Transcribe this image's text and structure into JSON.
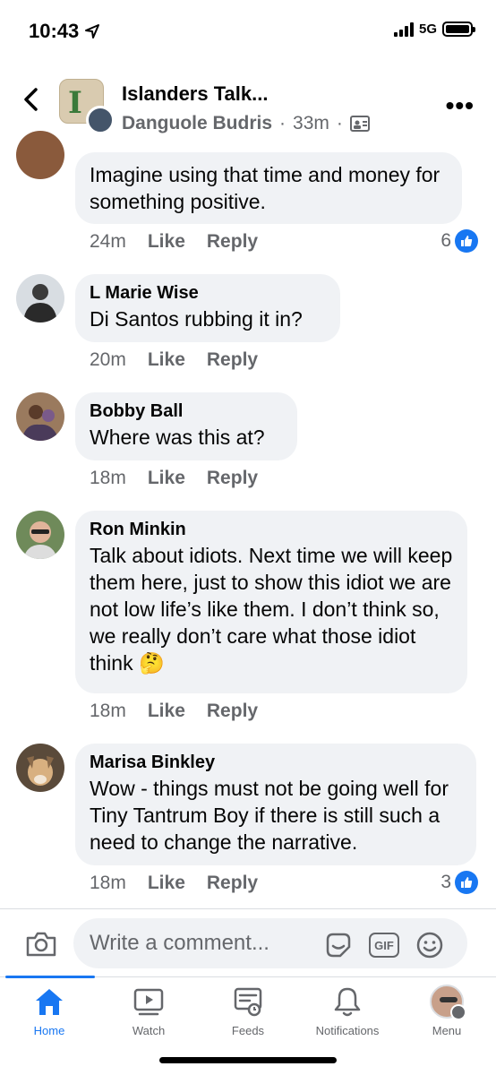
{
  "status_bar": {
    "time": "10:43",
    "network": "5G"
  },
  "header": {
    "title": "Islanders Talk...",
    "author": "Danguole Budris",
    "separator": "·",
    "age": "33m",
    "separator2": "·"
  },
  "comments": [
    {
      "name": "",
      "text": "Imagine using that time and money for something positive.",
      "age": "24m",
      "like_label": "Like",
      "reply_label": "Reply",
      "reactions": "6"
    },
    {
      "name": "L Marie Wise",
      "text": "Di Santos rubbing it in?",
      "age": "20m",
      "like_label": "Like",
      "reply_label": "Reply"
    },
    {
      "name": "Bobby Ball",
      "text": "Where was this at?",
      "age": "18m",
      "like_label": "Like",
      "reply_label": "Reply"
    },
    {
      "name": "Ron Minkin",
      "text": "Talk about idiots. Next time we will keep them here, just to show this idiot we are not low life’s like them. I don’t think so, we really don’t care what those idiot think",
      "emoji": "🤔",
      "age": "18m",
      "like_label": "Like",
      "reply_label": "Reply"
    },
    {
      "name": "Marisa Binkley",
      "text": "Wow - things must not be going well for Tiny Tantrum Boy if there is still such a need to change the narrative.",
      "age": "18m",
      "like_label": "Like",
      "reply_label": "Reply",
      "reactions": "3"
    }
  ],
  "composer": {
    "placeholder": "Write a comment...",
    "gif_label": "GIF"
  },
  "tabs": [
    {
      "label": "Home",
      "icon": "home-icon"
    },
    {
      "label": "Watch",
      "icon": "watch-icon"
    },
    {
      "label": "Feeds",
      "icon": "feeds-icon"
    },
    {
      "label": "Notifications",
      "icon": "bell-icon"
    },
    {
      "label": "Menu",
      "icon": "menu-avatar-icon"
    }
  ],
  "colors": {
    "accent": "#1877f2",
    "bubble": "#f0f2f5",
    "secondary_text": "#65676b"
  }
}
